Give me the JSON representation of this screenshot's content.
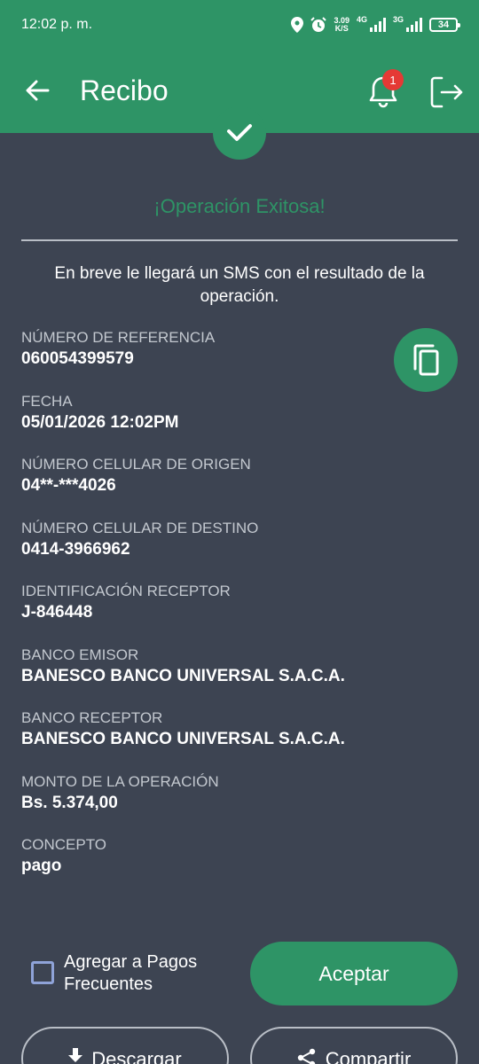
{
  "status_bar": {
    "time": "12:02 p. m.",
    "net_speed": "3.09",
    "net_speed_unit": "K/S",
    "net_4g": "4G",
    "net_3g": "3G",
    "battery": "34",
    "icons": [
      "location-icon",
      "alarm-icon",
      "signal-icon",
      "battery-icon"
    ]
  },
  "header": {
    "title": "Recibo",
    "notification_count": "1",
    "icons": [
      "arrow-left-icon",
      "bell-icon",
      "logout-icon"
    ]
  },
  "receipt": {
    "status_title": "¡Operación Exitosa!",
    "sms_note": "En breve le llegará un SMS con el resultado de la operación.",
    "fields": [
      {
        "label": "NÚMERO DE REFERENCIA",
        "value": "060054399579"
      },
      {
        "label": "FECHA",
        "value": "05/01/2026 12:02PM"
      },
      {
        "label": "NÚMERO CELULAR DE ORIGEN",
        "value": "04**-***4026"
      },
      {
        "label": "NÚMERO CELULAR DE DESTINO",
        "value": "0414-3966962"
      },
      {
        "label": "IDENTIFICACIÓN RECEPTOR",
        "value": "J-846448"
      },
      {
        "label": "BANCO EMISOR",
        "value": "BANESCO BANCO UNIVERSAL S.A.C.A."
      },
      {
        "label": "BANCO RECEPTOR",
        "value": "BANESCO BANCO UNIVERSAL S.A.C.A."
      },
      {
        "label": "MONTO DE LA OPERACIÓN",
        "value": "Bs. 5.374,00"
      },
      {
        "label": "CONCEPTO",
        "value": "pago"
      }
    ]
  },
  "actions": {
    "frequent_checkbox_label": "Agregar a Pagos Frecuentes",
    "frequent_checked": false,
    "accept_label": "Aceptar",
    "download_label": "Descargar",
    "share_label": "Compartir"
  },
  "colors": {
    "primary": "#2e9466",
    "background": "#3d4452",
    "badge": "#e53935"
  }
}
